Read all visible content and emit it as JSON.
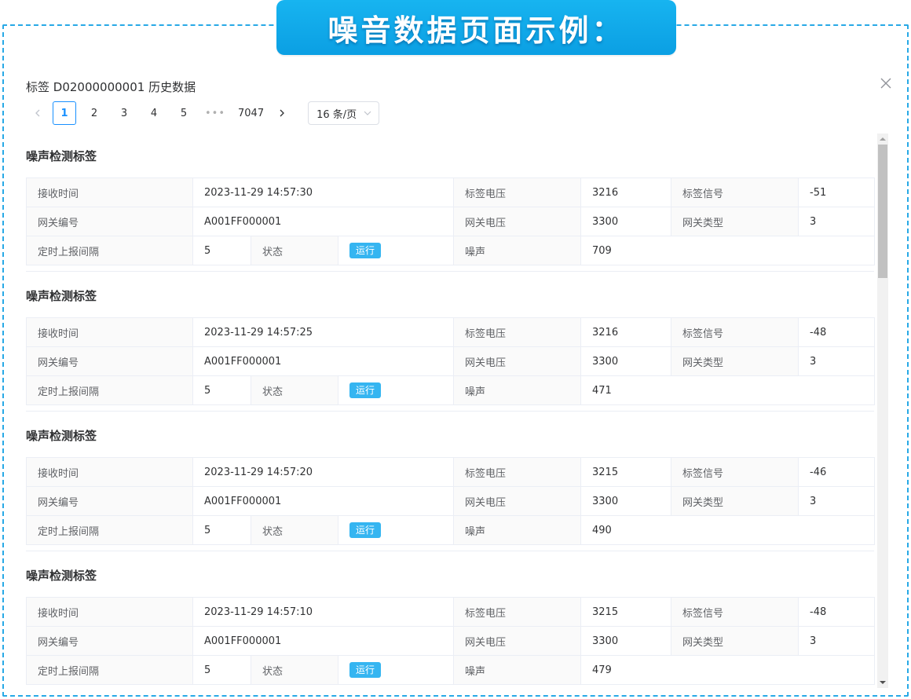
{
  "banner": {
    "title": "噪音数据页面示例："
  },
  "dialog": {
    "title": "标签 D02000000001 历史数据"
  },
  "pagination": {
    "pages": [
      "1",
      "2",
      "3",
      "4",
      "5"
    ],
    "ellipsis": "•••",
    "last_page": "7047",
    "current": "1",
    "page_size": "16 条/页"
  },
  "colors": {
    "accent": "#1890ff",
    "banner": "#0ea5e9",
    "tag": "#35b5f1"
  },
  "labels": {
    "section_title": "噪声检测标签",
    "receive_time": "接收时间",
    "tag_voltage": "标签电压",
    "tag_signal": "标签信号",
    "gateway_id": "网关编号",
    "gateway_voltage": "网关电压",
    "gateway_type": "网关类型",
    "report_interval": "定时上报间隔",
    "status": "状态",
    "noise": "噪声"
  },
  "records": [
    {
      "receive_time": "2023-11-29 14:57:30",
      "tag_voltage": "3216",
      "tag_signal": "-51",
      "gateway_id": "A001FF000001",
      "gateway_voltage": "3300",
      "gateway_type": "3",
      "report_interval": "5",
      "status": "运行",
      "noise": "709"
    },
    {
      "receive_time": "2023-11-29 14:57:25",
      "tag_voltage": "3216",
      "tag_signal": "-48",
      "gateway_id": "A001FF000001",
      "gateway_voltage": "3300",
      "gateway_type": "3",
      "report_interval": "5",
      "status": "运行",
      "noise": "471"
    },
    {
      "receive_time": "2023-11-29 14:57:20",
      "tag_voltage": "3215",
      "tag_signal": "-46",
      "gateway_id": "A001FF000001",
      "gateway_voltage": "3300",
      "gateway_type": "3",
      "report_interval": "5",
      "status": "运行",
      "noise": "490"
    },
    {
      "receive_time": "2023-11-29 14:57:10",
      "tag_voltage": "3215",
      "tag_signal": "-48",
      "gateway_id": "A001FF000001",
      "gateway_voltage": "3300",
      "gateway_type": "3",
      "report_interval": "5",
      "status": "运行",
      "noise": "479"
    }
  ]
}
